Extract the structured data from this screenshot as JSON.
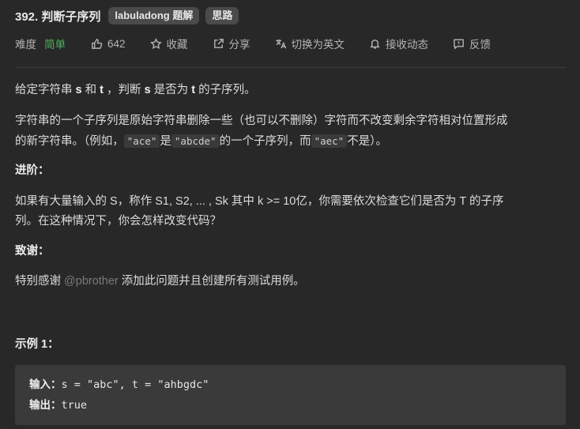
{
  "problem": {
    "title": "392. 判断子序列",
    "tags": [
      "labuladong 题解",
      "思路"
    ]
  },
  "meta": {
    "difficulty_label": "难度",
    "difficulty_value": "简单",
    "likes": "642",
    "favorite": "收藏",
    "share": "分享",
    "switch_lang": "切换为英文",
    "subscribe": "接收动态",
    "feedback": "反馈"
  },
  "description": {
    "p1_pre": "给定字符串 ",
    "p1_s": "s",
    "p1_mid1": " 和 ",
    "p1_t": "t",
    "p1_mid2": " ，判断 ",
    "p1_s2": "s",
    "p1_mid3": " 是否为 ",
    "p1_t2": "t",
    "p1_post": " 的子序列。",
    "p2_line1": "字符串的一个子序列是原始字符串删除一些（也可以不删除）字符而不改变剩余字符相对位置形成",
    "p2_line2_pre": "的新字符串。（例如，",
    "p2_code1": "\"ace\"",
    "p2_mid1": "是",
    "p2_code2": "\"abcde\"",
    "p2_mid2": "的一个子序列，而",
    "p2_code3": "\"aec\"",
    "p2_post": "不是）。",
    "advanced_heading": "进阶：",
    "advanced_line1": "如果有大量输入的 S，称作 S1, S2, ... , Sk 其中 k >= 10亿，你需要依次检查它们是否为 T 的子序",
    "advanced_line2": "列。在这种情况下，你会怎样改变代码？",
    "thanks_heading": "致谢：",
    "thanks_pre": "特别感谢 ",
    "thanks_user": "@pbrother",
    "thanks_post": " 添加此问题并且创建所有测试用例。",
    "example_heading": "示例 1："
  },
  "example": {
    "input_label": "输入：",
    "input_value": "s = \"abc\", t = \"ahbgdc\"",
    "output_label": "输出：",
    "output_value": "true"
  }
}
